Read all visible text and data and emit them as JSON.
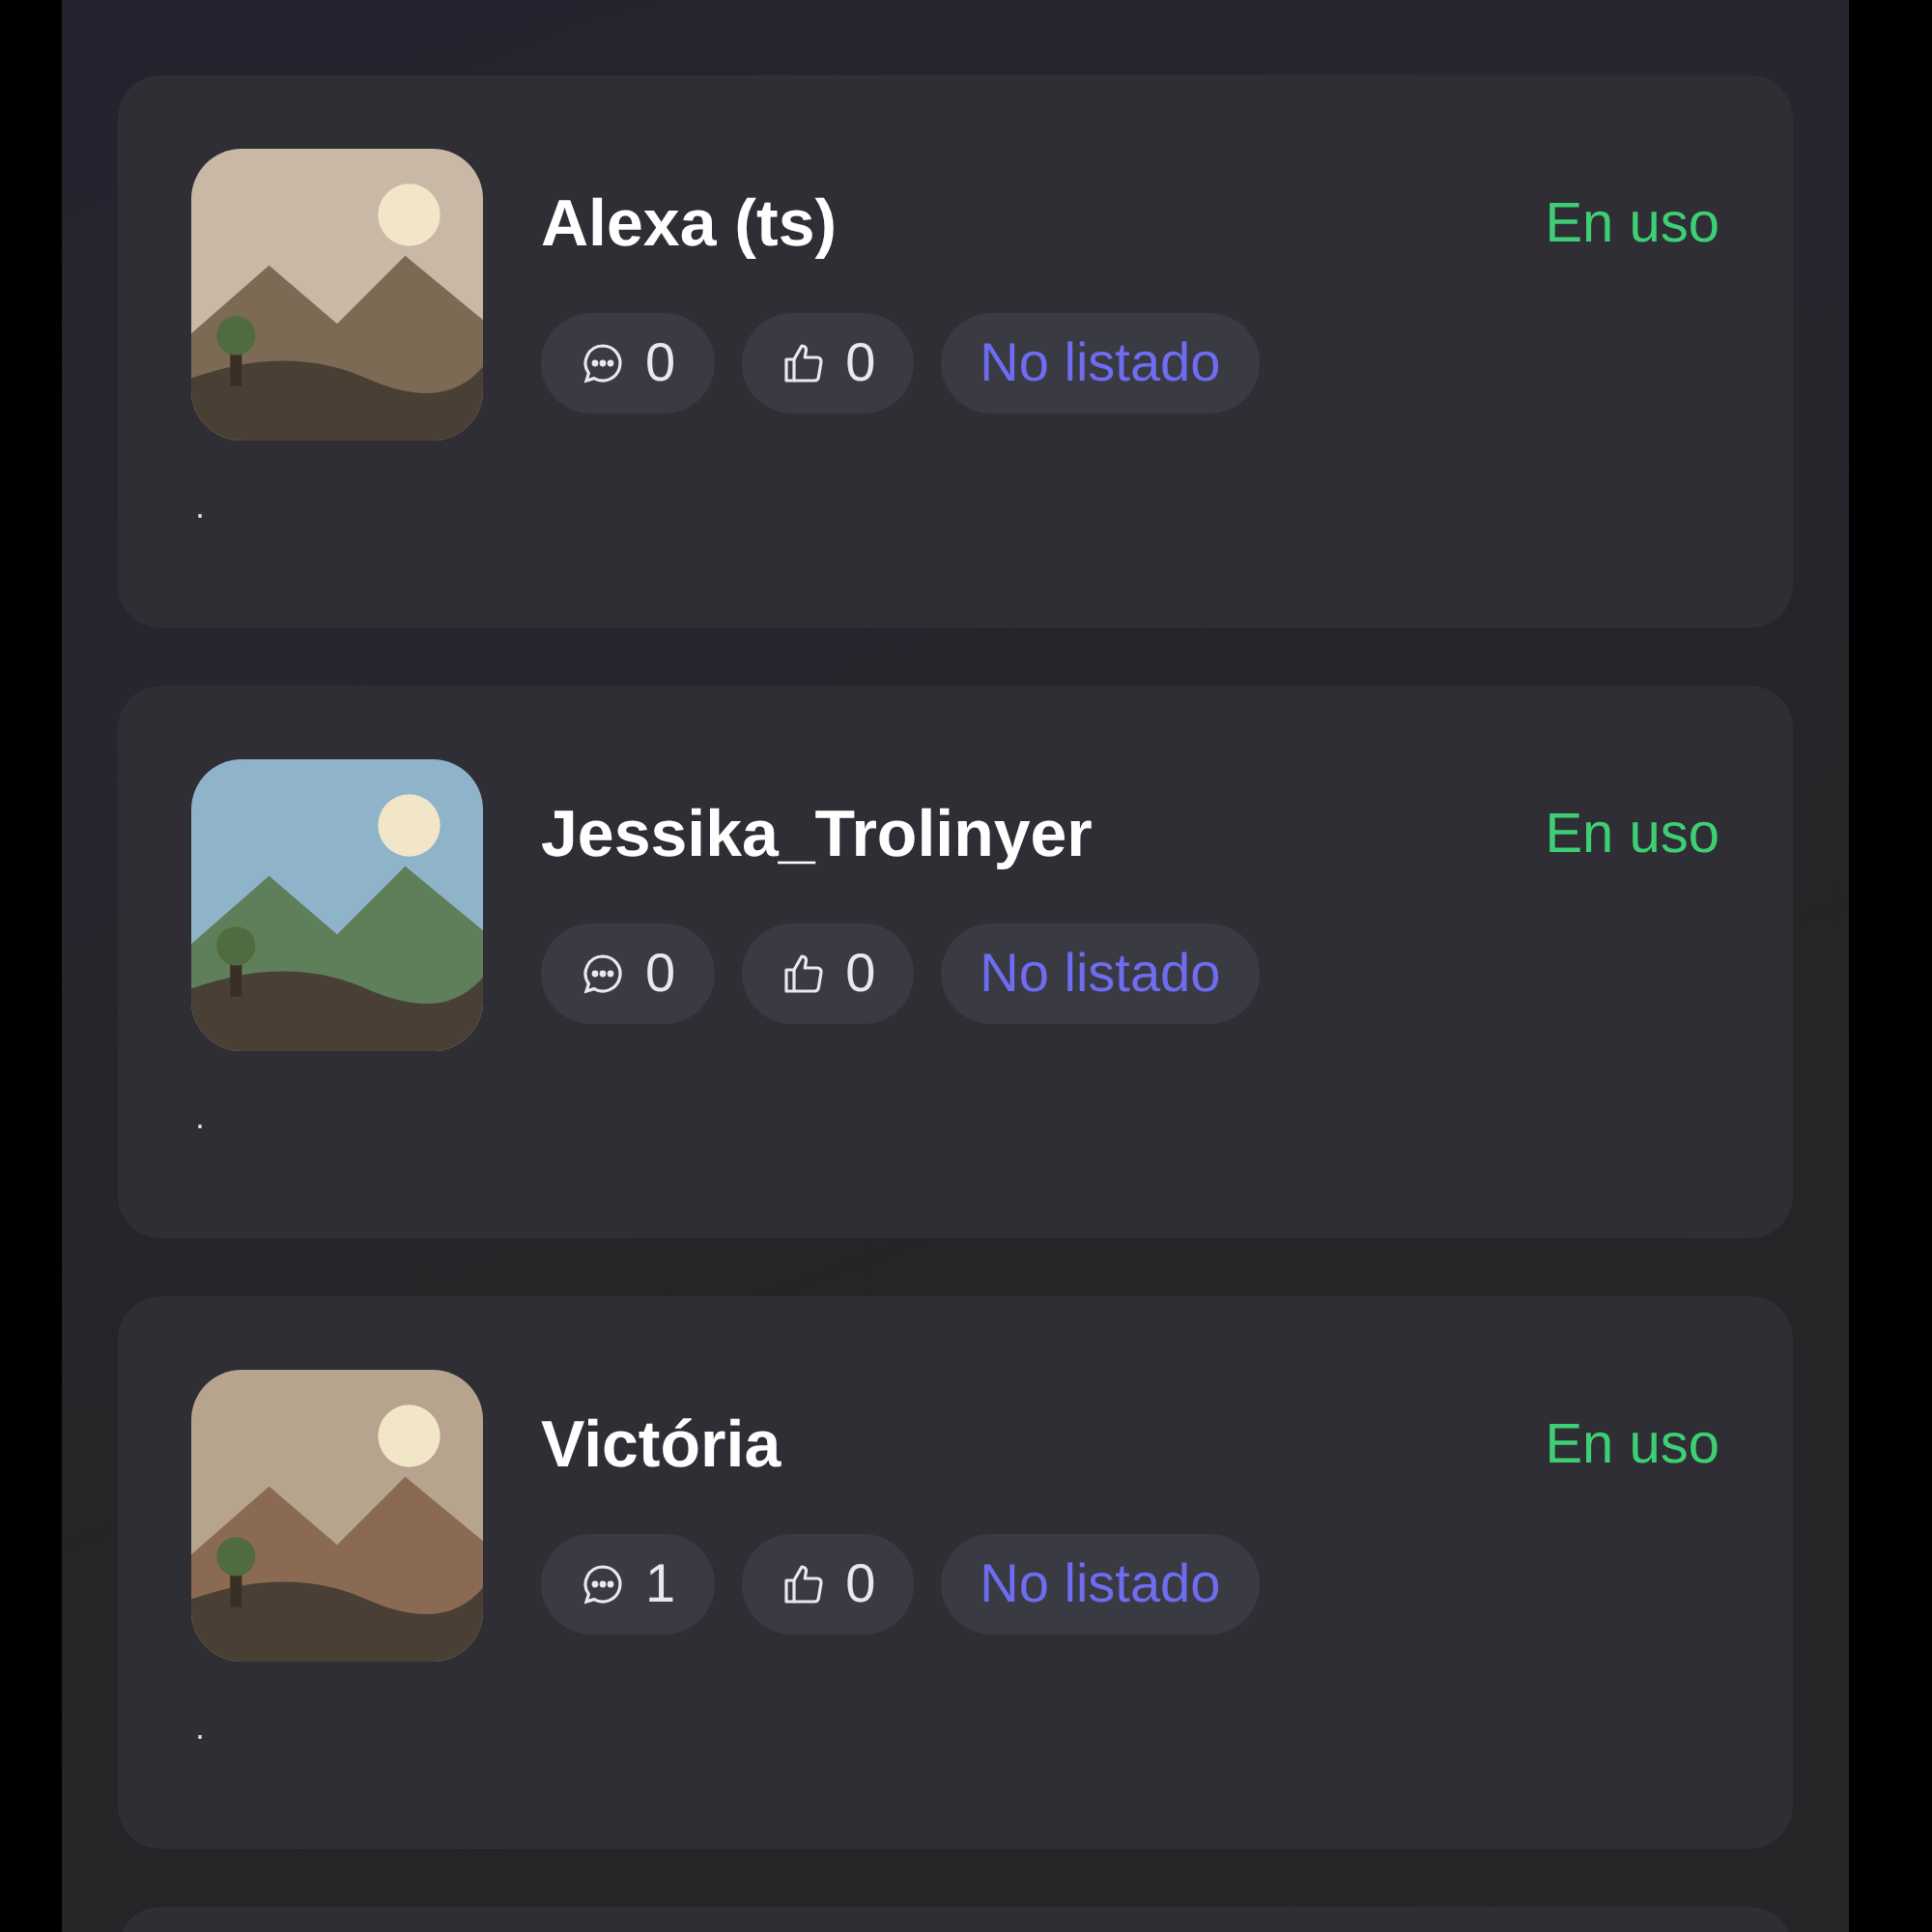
{
  "cards": [
    {
      "name": "Alexa (ts)",
      "status": "En uso",
      "comments": "0",
      "likes": "0",
      "visibility": "No listado",
      "description": "."
    },
    {
      "name": "Jessika_Trolinyer",
      "status": "En uso",
      "comments": "0",
      "likes": "0",
      "visibility": "No listado",
      "description": "."
    },
    {
      "name": "Victória",
      "status": "En uso",
      "comments": "1",
      "likes": "0",
      "visibility": "No listado",
      "description": "."
    }
  ]
}
